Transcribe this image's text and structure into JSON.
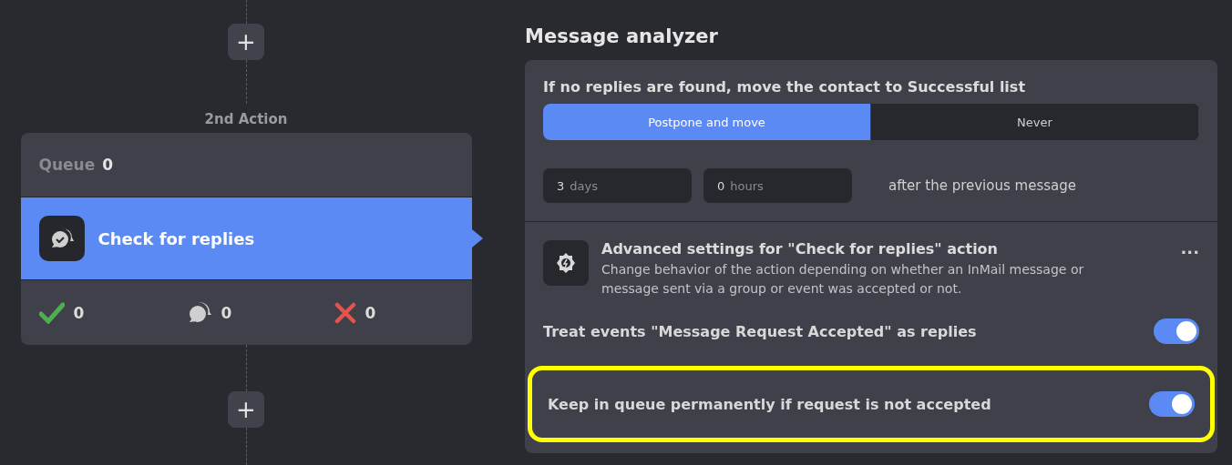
{
  "flow": {
    "add_buttons": [
      "+",
      "+"
    ],
    "step_label": "2nd Action",
    "card": {
      "queue_label": "Queue",
      "queue_count": "0",
      "action_title": "Check for replies",
      "selected": true,
      "stats": [
        {
          "kind": "success",
          "count": "0"
        },
        {
          "kind": "replied",
          "count": "0"
        },
        {
          "kind": "failed",
          "count": "0"
        }
      ]
    }
  },
  "panel": {
    "title": "Message analyzer",
    "condition": {
      "heading": "If no replies are found, move the contact to Successful list",
      "options": [
        {
          "label": "Postpone and move",
          "selected": true
        },
        {
          "label": "Never",
          "selected": false
        }
      ],
      "delay": [
        {
          "value": "3",
          "unit": "days"
        },
        {
          "value": "0",
          "unit": "hours"
        }
      ],
      "delay_suffix": "after the previous message"
    },
    "advanced": {
      "title": "Advanced settings for \"Check for replies\" action",
      "description": "Change behavior of the action depending on whether an InMail message or message sent via a group or event was accepted or not.",
      "menu": "...",
      "toggles": [
        {
          "label": "Treat events \"Message Request Accepted\" as replies",
          "on": true,
          "highlighted": false
        },
        {
          "label": "Keep in queue permanently if request is not accepted",
          "on": true,
          "highlighted": true
        }
      ]
    }
  }
}
